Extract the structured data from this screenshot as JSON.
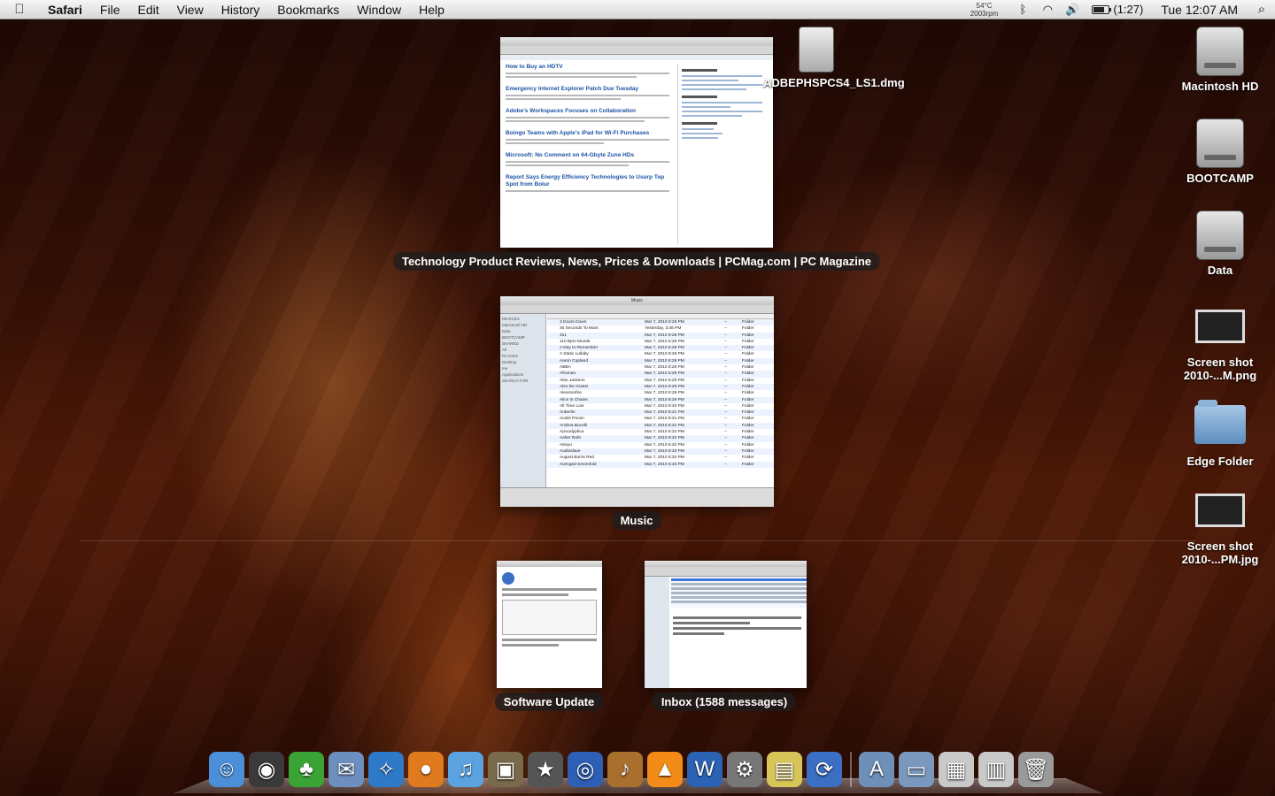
{
  "menubar": {
    "apple_glyph": "",
    "app_name": "Safari",
    "menus": [
      "File",
      "Edit",
      "View",
      "History",
      "Bookmarks",
      "Window",
      "Help"
    ],
    "temperature": "54°C",
    "fan_speed": "2003rpm",
    "battery_time": "(1:27)",
    "battery_level": 0.7,
    "clock": "Tue 12:07 AM"
  },
  "expose": {
    "browser": {
      "label": "Technology Product Reviews, News, Prices & Downloads | PCMag.com | PC Magazine",
      "articles": [
        "How to Buy an HDTV",
        "Emergency Internet Explorer Patch Due Tuesday",
        "Adobe's Workspaces Focuses on Collaboration",
        "Boingo Teams with Apple's iPad for Wi-Fi Purchases",
        "Microsoft: No Comment on 64-Gbyte Zune HDs",
        "Report Says Energy Efficiency Technologies to Usurp Top Spot from Bolur"
      ]
    },
    "finder": {
      "label": "Music",
      "title": "Music",
      "sidebar": [
        "DEVICES",
        "Macintosh HD",
        "Data",
        "BOOTCAMP",
        "SHARED",
        "All",
        "PLACES",
        "Desktop",
        "me",
        "Applications",
        "SEARCH FOR"
      ],
      "rows": [
        [
          "3 Doors Down",
          "Mar 7, 2010 8:28 PM",
          "--",
          "Folder"
        ],
        [
          "30 Seconds To Mars",
          "Yesterday, 3:46 PM",
          "--",
          "Folder"
        ],
        [
          "311",
          "Mar 7, 2010 8:28 PM",
          "--",
          "Folder"
        ],
        [
          "110 Bpm Muzak",
          "Mar 7, 2010 8:28 PM",
          "--",
          "Folder"
        ],
        [
          "A Day to Remember",
          "Mar 7, 2010 8:28 PM",
          "--",
          "Folder"
        ],
        [
          "A Static Lullaby",
          "Mar 7, 2010 8:28 PM",
          "--",
          "Folder"
        ],
        [
          "Aaron Copland",
          "Mar 7, 2010 8:29 PM",
          "--",
          "Folder"
        ],
        [
          "ABBA",
          "Mar 7, 2010 8:29 PM",
          "--",
          "Folder"
        ],
        [
          "Afroman",
          "Mar 7, 2010 8:29 PM",
          "--",
          "Folder"
        ],
        [
          "Alan Jackson",
          "Mar 7, 2010 8:29 PM",
          "--",
          "Folder"
        ],
        [
          "Alex De Grassi",
          "Mar 7, 2010 8:29 PM",
          "--",
          "Folder"
        ],
        [
          "Alexisonfire",
          "Mar 7, 2010 8:29 PM",
          "--",
          "Folder"
        ],
        [
          "Alice in Chains",
          "Mar 7, 2010 8:29 PM",
          "--",
          "Folder"
        ],
        [
          "All Time Low",
          "Mar 7, 2010 8:30 PM",
          "--",
          "Folder"
        ],
        [
          "Anberlin",
          "Mar 7, 2010 8:31 PM",
          "--",
          "Folder"
        ],
        [
          "André Previn",
          "Mar 7, 2010 8:31 PM",
          "--",
          "Folder"
        ],
        [
          "Andrea Bocelli",
          "Mar 7, 2010 8:31 PM",
          "--",
          "Folder"
        ],
        [
          "Apocalyptica",
          "Mar 7, 2010 8:32 PM",
          "--",
          "Folder"
        ],
        [
          "Asher Roth",
          "Mar 7, 2010 8:32 PM",
          "--",
          "Folder"
        ],
        [
          "Atreyu",
          "Mar 7, 2010 8:32 PM",
          "--",
          "Folder"
        ],
        [
          "Audioslave",
          "Mar 7, 2010 8:33 PM",
          "--",
          "Folder"
        ],
        [
          "August Burns Red",
          "Mar 7, 2010 8:33 PM",
          "--",
          "Folder"
        ],
        [
          "Avenged Sevenfold",
          "Mar 7, 2010 8:33 PM",
          "--",
          "Folder"
        ]
      ]
    },
    "software_update": {
      "label": "Software Update"
    },
    "mail": {
      "label": "Inbox (1588 messages)"
    }
  },
  "desktop_icons": [
    {
      "label": "ADBEPHSPCS4_LS1.dmg",
      "icon": "disk-image-icon"
    },
    {
      "label": "Macintosh HD",
      "icon": "hard-drive-icon"
    },
    {
      "label": "BOOTCAMP",
      "icon": "hard-drive-icon"
    },
    {
      "label": "Data",
      "icon": "hard-drive-icon"
    },
    {
      "label": "Screen shot 2010-...M.png",
      "icon": "screenshot-icon"
    },
    {
      "label": "Edge Folder",
      "icon": "folder-icon"
    },
    {
      "label": "Screen shot 2010-...PM.jpg",
      "icon": "screenshot-icon"
    }
  ],
  "dock": {
    "apps": [
      {
        "name": "finder",
        "glyph": "☺",
        "color": "#4a8fd8"
      },
      {
        "name": "dashboard",
        "glyph": "◉",
        "color": "#3a3a3a"
      },
      {
        "name": "adium",
        "glyph": "♣",
        "color": "#3aa335"
      },
      {
        "name": "mail",
        "glyph": "✉",
        "color": "#6c8fbf"
      },
      {
        "name": "safari",
        "glyph": "✧",
        "color": "#2f79c9"
      },
      {
        "name": "firefox",
        "glyph": "●",
        "color": "#e07a1f"
      },
      {
        "name": "itunes",
        "glyph": "♫",
        "color": "#5aa2e0"
      },
      {
        "name": "iphoto",
        "glyph": "▣",
        "color": "#7a6a4c"
      },
      {
        "name": "imovie",
        "glyph": "★",
        "color": "#555555"
      },
      {
        "name": "dvd-player",
        "glyph": "◎",
        "color": "#2d5fb4"
      },
      {
        "name": "garageband",
        "glyph": "♪",
        "color": "#a86f2d"
      },
      {
        "name": "vlc",
        "glyph": "▲",
        "color": "#f28b17"
      },
      {
        "name": "word",
        "glyph": "W",
        "color": "#2b62b3"
      },
      {
        "name": "system-preferences",
        "glyph": "⚙",
        "color": "#777777"
      },
      {
        "name": "stickies",
        "glyph": "▤",
        "color": "#d8c558"
      },
      {
        "name": "software-update",
        "glyph": "⟳",
        "color": "#3b6fc4"
      }
    ],
    "stacks": [
      {
        "name": "applications-stack",
        "glyph": "A",
        "color": "#6d8fb8"
      },
      {
        "name": "documents-stack",
        "glyph": "▭",
        "color": "#7a98bd"
      },
      {
        "name": "downloads-stack",
        "glyph": "▦",
        "color": "#c9c9c9"
      },
      {
        "name": "screenshots-stack",
        "glyph": "▥",
        "color": "#c9c9c9"
      },
      {
        "name": "trash",
        "glyph": "🗑",
        "color": "#9a9a9a"
      }
    ]
  }
}
